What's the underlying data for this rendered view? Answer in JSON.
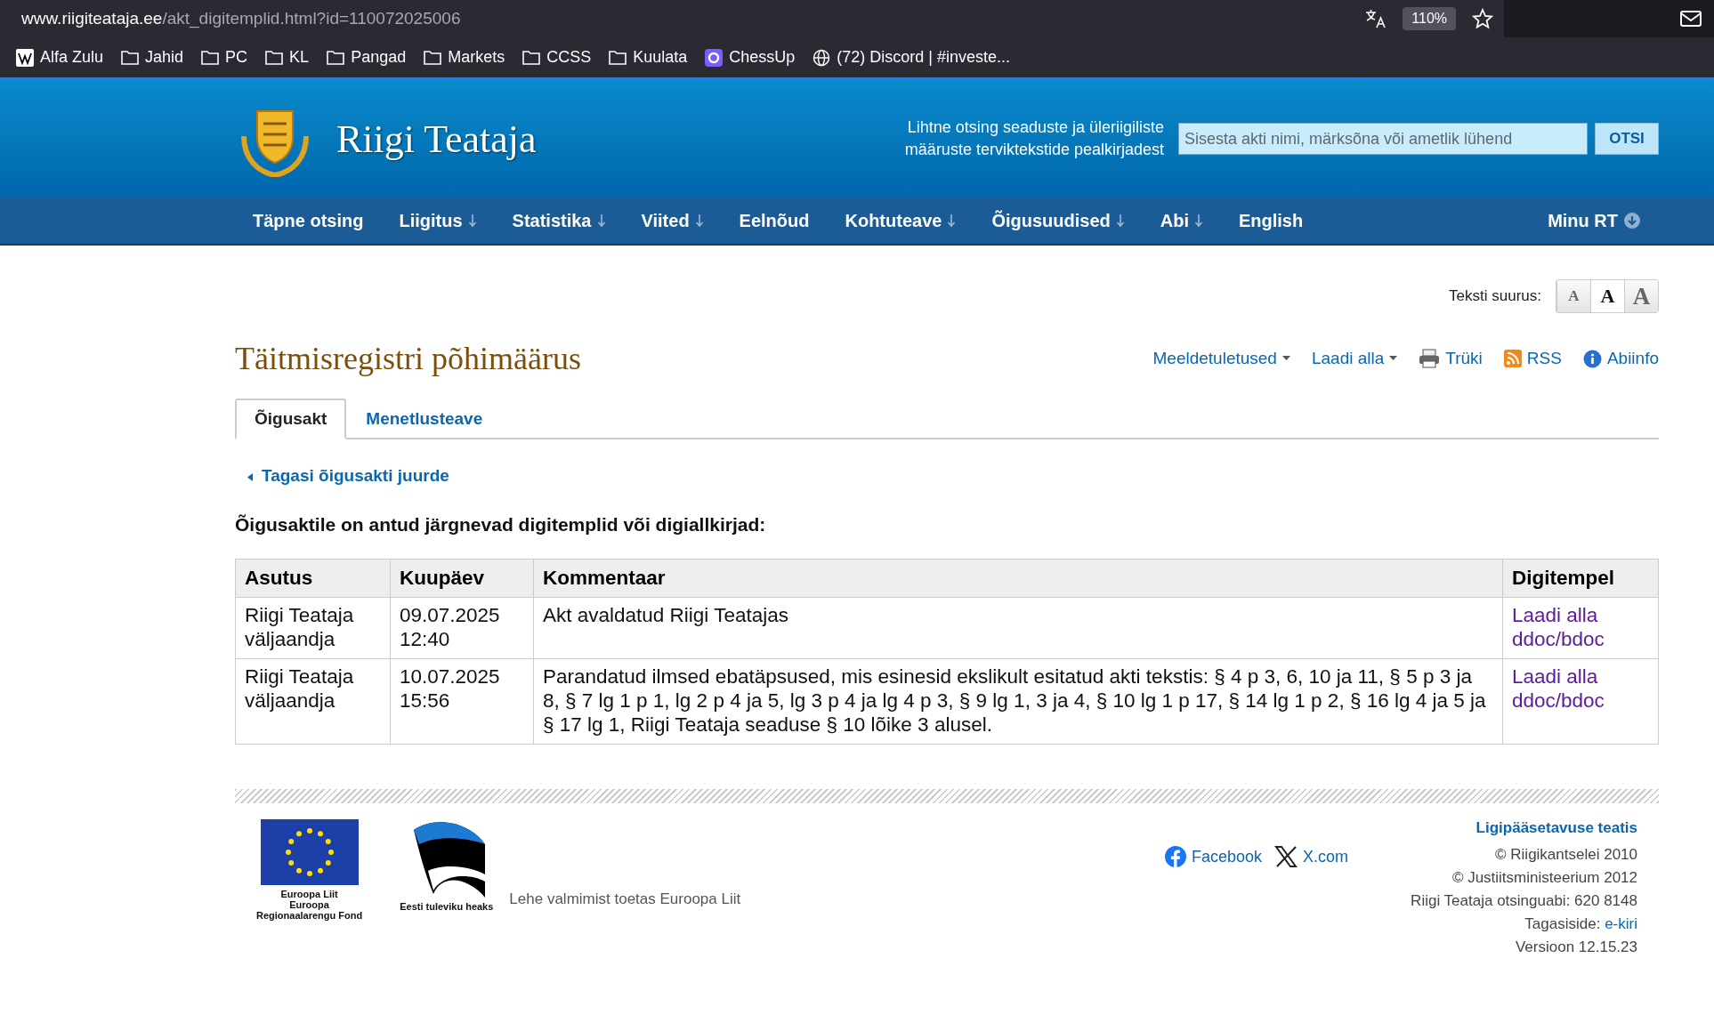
{
  "browser": {
    "url_host": "www.riigiteataja.ee",
    "url_path": "/akt_digitemplid.html?id=110072025006",
    "zoom": "110%",
    "bookmarks": [
      {
        "label": "Alfa Zulu",
        "kind": "wiki"
      },
      {
        "label": "Jahid",
        "kind": "folder"
      },
      {
        "label": "PC",
        "kind": "folder"
      },
      {
        "label": "KL",
        "kind": "folder"
      },
      {
        "label": "Pangad",
        "kind": "folder"
      },
      {
        "label": "Markets",
        "kind": "folder"
      },
      {
        "label": "CCSS",
        "kind": "folder"
      },
      {
        "label": "Kuulata",
        "kind": "folder"
      },
      {
        "label": "ChessUp",
        "kind": "app"
      },
      {
        "label": "(72) Discord | #investe...",
        "kind": "globe"
      }
    ]
  },
  "header": {
    "logo_text": "Riigi Teataja",
    "search_hint": "Lihtne otsing seaduste ja üleriigiliste määruste terviktekstide pealkirjadest",
    "search_placeholder": "Sisesta akti nimi, märksõna või ametlik lühend",
    "search_button": "OTSI"
  },
  "nav": [
    {
      "label": "Täpne otsing",
      "dropdown": false
    },
    {
      "label": "Liigitus",
      "dropdown": true
    },
    {
      "label": "Statistika",
      "dropdown": true
    },
    {
      "label": "Viited",
      "dropdown": true
    },
    {
      "label": "Eelnõud",
      "dropdown": false
    },
    {
      "label": "Kohtuteave",
      "dropdown": true
    },
    {
      "label": "Õigusuudised",
      "dropdown": true
    },
    {
      "label": "Abi",
      "dropdown": true
    },
    {
      "label": "English",
      "dropdown": false
    }
  ],
  "nav_user": "Minu RT",
  "text_size": {
    "label": "Teksti suurus:",
    "options": [
      {
        "label": "A",
        "selected": false
      },
      {
        "label": "A",
        "selected": true
      },
      {
        "label": "A",
        "selected": false
      }
    ]
  },
  "title": "Täitmisregistri põhimäärus",
  "actions": [
    {
      "label": "Meeldetuletused",
      "kind": "menu"
    },
    {
      "label": "Laadi alla",
      "kind": "menu"
    },
    {
      "label": "Trüki",
      "kind": "print"
    },
    {
      "label": "RSS",
      "kind": "rss"
    },
    {
      "label": "Abiinfo",
      "kind": "info"
    }
  ],
  "tabs": [
    {
      "label": "Õigusakt",
      "selected": true
    },
    {
      "label": "Menetlusteave",
      "selected": false
    }
  ],
  "back_link": "Tagasi õigusakti juurde",
  "heading": "Õigusaktile on antud järgnevad digitemplid või digiallkirjad:",
  "table": {
    "columns": [
      "Asutus",
      "Kuupäev",
      "Kommentaar",
      "Digitempel"
    ],
    "rows": [
      {
        "asutus": "Riigi Teataja väljaandja",
        "kuupaev": [
          "09.07.2025",
          "12:40"
        ],
        "kommentaar": "Akt avaldatud Riigi Teatajas",
        "link": [
          "Laadi alla",
          "ddoc/bdoc"
        ]
      },
      {
        "asutus": "Riigi Teataja väljaandja",
        "kuupaev": [
          "10.07.2025",
          "15:56"
        ],
        "kommentaar": "Parandatud ilmsed ebatäpsused, mis esinesid ekslikult esitatud akti tekstis: § 4 p 3, 6, 10 ja 11, § 5 p 3 ja 8, § 7 lg 1 p 1, lg 2 p 4 ja 5, lg 3 p 4 ja lg 4 p 3, § 9 lg 1, 3 ja 4, § 10 lg 1 p 17, § 14 lg 1 p 2, § 16 lg 4 ja 5 ja § 17 lg 1, Riigi Teataja seaduse § 10 lõike 3 alusel.",
        "link": [
          "Laadi alla",
          "ddoc/bdoc"
        ]
      }
    ]
  },
  "footer": {
    "eu_caption": [
      "Euroopa Liit",
      "Euroopa",
      "Regionaalarengu Fond"
    ],
    "ee_caption": "Eesti tuleviku heaks",
    "support": "Lehe valmimist toetas Euroopa Liit",
    "social": [
      {
        "label": "Facebook",
        "kind": "facebook"
      },
      {
        "label": "X.com",
        "kind": "x"
      }
    ],
    "accessibility": "Ligipääsetavuse teatis",
    "lines": [
      {
        "text": "© Riigikantselei 2010"
      },
      {
        "text": "© Justiitsministeerium 2012"
      },
      {
        "text": "Riigi Teataja otsinguabi: 620 8148"
      },
      {
        "text": "Tagasiside:",
        "link": "e-kiri"
      },
      {
        "text": "Versioon 12.15.23"
      }
    ]
  }
}
